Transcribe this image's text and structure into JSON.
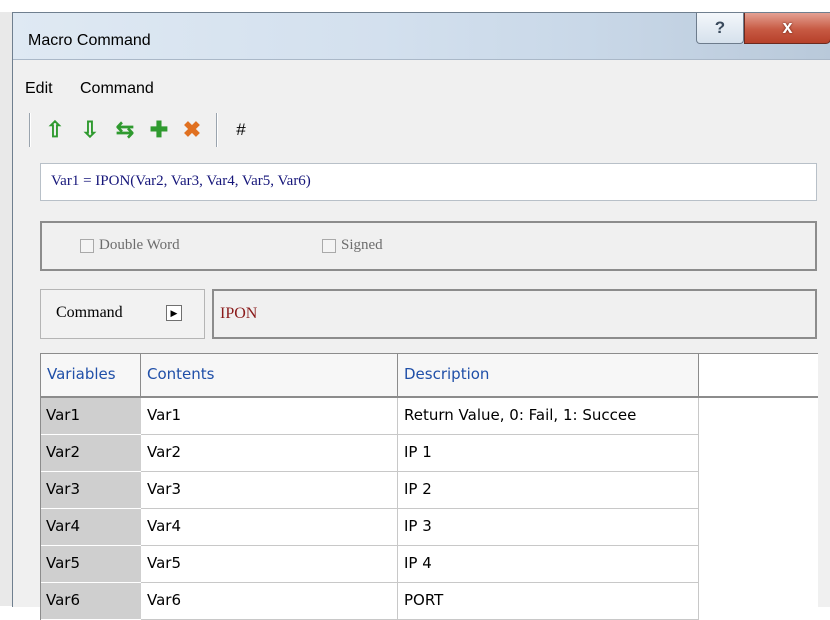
{
  "window": {
    "title": "Macro Command",
    "help_glyph": "?",
    "close_glyph": "x"
  },
  "menu": {
    "items": [
      "Edit",
      "Command"
    ]
  },
  "toolbar": {
    "buttons": [
      {
        "name": "move-up-icon",
        "glyph": "⇧",
        "color": "#2f9a2f"
      },
      {
        "name": "move-down-icon",
        "glyph": "⇩",
        "color": "#2f9a2f"
      },
      {
        "name": "swap-icon",
        "glyph": "⇆",
        "color": "#2f9a2f"
      },
      {
        "name": "add-icon",
        "glyph": "✚",
        "color": "#2f9a2f"
      },
      {
        "name": "delete-icon",
        "glyph": "✖",
        "color": "#e07020"
      }
    ],
    "hash_label": "#"
  },
  "formula": {
    "text": "Var1 = IPON(Var2, Var3, Var4, Var5, Var6)"
  },
  "options": {
    "double_word_label": "Double Word",
    "signed_label": "Signed"
  },
  "command": {
    "button_label": "Command",
    "value": "IPON"
  },
  "table": {
    "headers": [
      "Variables",
      "Contents",
      "Description"
    ],
    "rows": [
      {
        "variable": "Var1",
        "contents": "Var1",
        "description": "Return Value, 0: Fail, 1: Succee"
      },
      {
        "variable": "Var2",
        "contents": "Var2",
        "description": "IP 1"
      },
      {
        "variable": "Var3",
        "contents": "Var3",
        "description": "IP 2"
      },
      {
        "variable": "Var4",
        "contents": "Var4",
        "description": "IP 3"
      },
      {
        "variable": "Var5",
        "contents": "Var5",
        "description": "IP 4"
      },
      {
        "variable": "Var6",
        "contents": "Var6",
        "description": "PORT"
      }
    ]
  }
}
